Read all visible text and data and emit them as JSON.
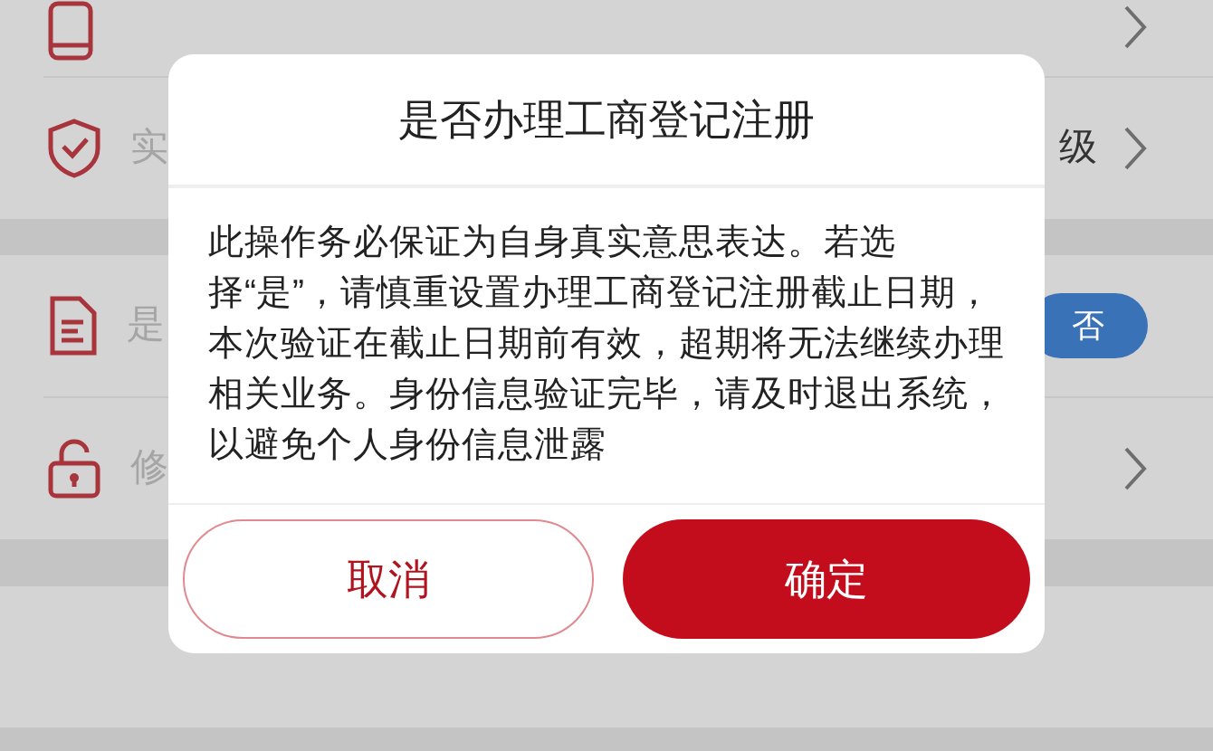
{
  "settings_rows": [
    {
      "label": "实",
      "value": "级"
    },
    {
      "label": "是",
      "toggle": {
        "label": "否",
        "on": false
      }
    },
    {
      "label": "修"
    }
  ],
  "dialog": {
    "title": "是否办理工商登记注册",
    "message": "此操作务必保证为自身真实意思表达。若选择“是”，请慎重设置办理工商登记注册截止日期，本次验证在截止日期前有效，超期将无法继续办理相关业务。身份信息验证完毕，请及时退出系统，以避免个人身份信息泄露",
    "buttons": [
      {
        "label": "取消",
        "kind": "secondary"
      },
      {
        "label": "确定",
        "kind": "primary"
      }
    ]
  }
}
